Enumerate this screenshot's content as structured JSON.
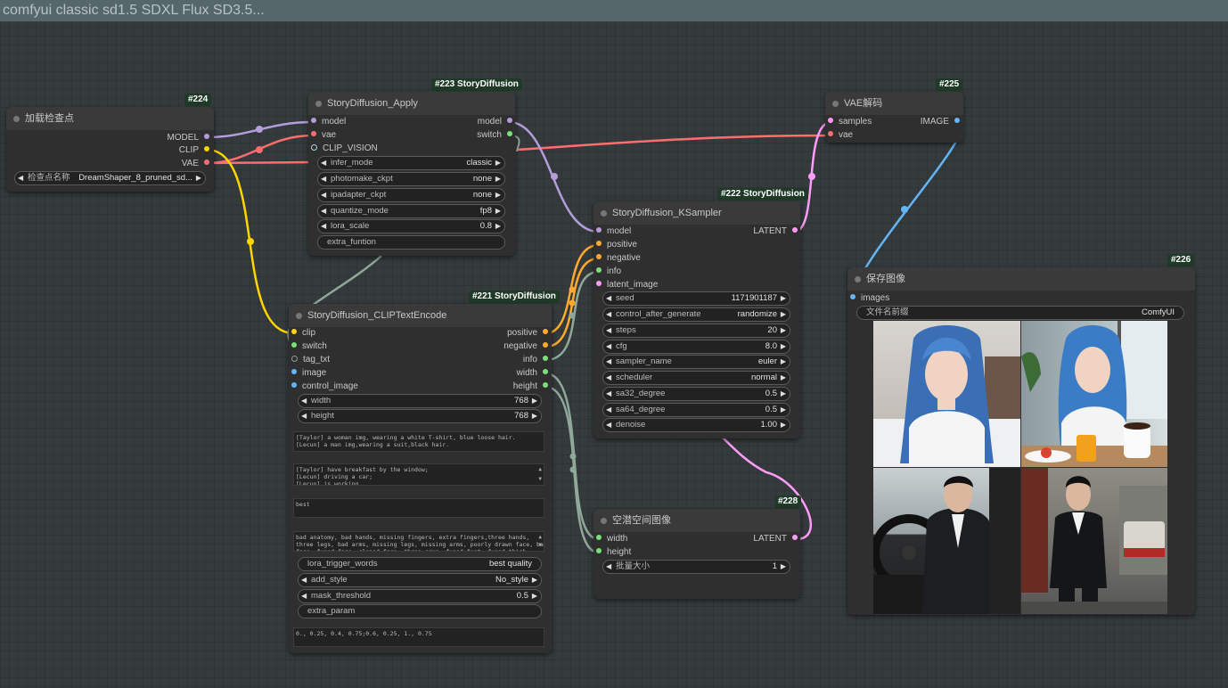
{
  "title": "comfyui classic sd1.5 SDXL Flux SD3.5...",
  "colors": {
    "model": "#b39ddb",
    "clip": "#ffd500",
    "vae": "#ff6e6e",
    "latent": "#ff9cf9",
    "image": "#64b5f6",
    "string": "#7ae07a",
    "int": "#7ae07a",
    "conditioning": "#ffa931",
    "clip_vision": "#a8dadc"
  },
  "node224": {
    "badge": "#224",
    "title": "加载检查点",
    "outputs": {
      "model": "MODEL",
      "clip": "CLIP",
      "vae": "VAE"
    },
    "w_ckpt": {
      "label": "检查点名称",
      "value": "DreamShaper_8_pruned_sd..."
    }
  },
  "node223": {
    "badge": "#223 StoryDiffusion",
    "title": "StoryDiffusion_Apply",
    "inputs": {
      "model": "model",
      "vae": "vae",
      "clip_vision": "CLIP_VISION"
    },
    "outputs": {
      "model": "model",
      "switch": "switch"
    },
    "widgets": [
      {
        "label": "infer_mode",
        "value": "classic"
      },
      {
        "label": "photomake_ckpt",
        "value": "none"
      },
      {
        "label": "ipadapter_ckpt",
        "value": "none"
      },
      {
        "label": "quantize_mode",
        "value": "fp8"
      },
      {
        "label": "lora_scale",
        "value": "0.8"
      }
    ],
    "extra": "extra_funtion"
  },
  "node221": {
    "badge": "#221 StoryDiffusion",
    "title": "StoryDiffusion_CLIPTextEncode",
    "inputs": {
      "clip": "clip",
      "switch": "switch",
      "tag_txt": "tag_txt",
      "image": "image",
      "control_image": "control_image"
    },
    "outputs": {
      "positive": "positive",
      "negative": "negative",
      "info": "info",
      "width": "width",
      "height": "height"
    },
    "w_width": {
      "label": "width",
      "value": "768"
    },
    "w_height": {
      "label": "height",
      "value": "768"
    },
    "text1": "[Taylor] a woman img, wearing a white T-shirt, blue loose hair.\n[Lecun] a man img,wearing a suit,black hair.",
    "text2": "[Taylor] have breakfast by the window;\n[Lecun] driving a car;\n[Lecun] is working.",
    "text3": "best",
    "text4": "bad anatomy, bad hands, missing fingers, extra fingers,three hands,\nthree legs, bad arms, missing legs, missing arms, poorly drawn face, bad\nface, fused face, cloned face, three crus, fused feet, fused thigh",
    "w_lora": {
      "label": "lora_trigger_words",
      "value": "best quality"
    },
    "w_style": {
      "label": "add_style",
      "value": "No_style"
    },
    "w_mask": {
      "label": "mask_threshold",
      "value": "0.5"
    },
    "extra": "extra_param",
    "text5": "0., 0.25, 0.4, 0.75;0.6, 0.25, 1., 0.75"
  },
  "node222": {
    "badge": "#222 StoryDiffusion",
    "title": "StoryDiffusion_KSampler",
    "inputs": {
      "model": "model",
      "positive": "positive",
      "negative": "negative",
      "info": "info",
      "latent_image": "latent_image"
    },
    "output": "LATENT",
    "widgets": [
      {
        "label": "seed",
        "value": "1171901187"
      },
      {
        "label": "control_after_generate",
        "value": "randomize"
      },
      {
        "label": "steps",
        "value": "20"
      },
      {
        "label": "cfg",
        "value": "8.0"
      },
      {
        "label": "sampler_name",
        "value": "euler"
      },
      {
        "label": "scheduler",
        "value": "normal"
      },
      {
        "label": "sa32_degree",
        "value": "0.5"
      },
      {
        "label": "sa64_degree",
        "value": "0.5"
      },
      {
        "label": "denoise",
        "value": "1.00"
      }
    ]
  },
  "node225": {
    "badge": "#225",
    "title": "VAE解码",
    "inputs": {
      "samples": "samples",
      "vae": "vae"
    },
    "output": "IMAGE"
  },
  "node228": {
    "badge": "#228",
    "title": "空潜空间图像",
    "inputs": {
      "width": "width",
      "height": "height"
    },
    "output": "LATENT",
    "w_batch": {
      "label": "批量大小",
      "value": "1"
    }
  },
  "node226": {
    "badge": "#226",
    "title": "保存图像",
    "input": "images",
    "w_prefix": {
      "label": "文件名前缀",
      "value": "ComfyUI"
    },
    "images": [
      "woman-in-bed-photo",
      "woman-breakfast-photo",
      "man-driving-photo",
      "man-street-photo"
    ]
  }
}
